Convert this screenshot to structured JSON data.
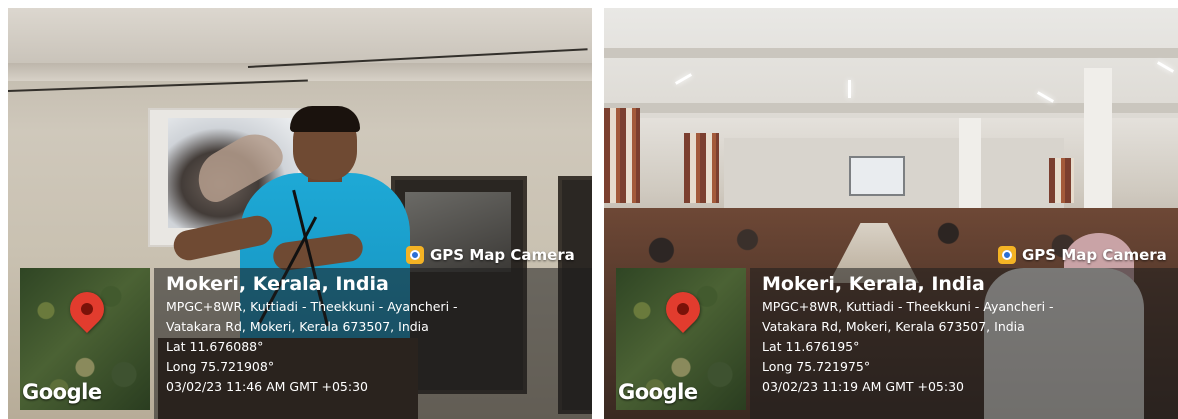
{
  "photos": [
    {
      "badge": "GPS Map Camera",
      "place": "Mokeri, Kerala, India",
      "address_line1": "MPGC+8WR, Kuttiadi - Theekkuni - Ayancheri -",
      "address_line2": "Vatakara Rd, Mokeri, Kerala 673507, India",
      "lat": "Lat 11.676088°",
      "long": "Long 75.721908°",
      "datetime": "03/02/23 11:46 AM GMT +05:30",
      "map_label": "Google",
      "pin_icon": "map-pin-icon",
      "pin_color": "#e23c2e"
    },
    {
      "badge": "GPS Map Camera",
      "place": "Mokeri, Kerala, India",
      "address_line1": "MPGC+8WR, Kuttiadi - Theekkuni - Ayancheri -",
      "address_line2": "Vatakara Rd, Mokeri, Kerala 673507, India",
      "lat": "Lat 11.676195°",
      "long": "Long 75.721975°",
      "datetime": "03/02/23 11:19 AM GMT +05:30",
      "map_label": "Google",
      "pin_icon": "map-pin-icon",
      "pin_color": "#e23c2e"
    }
  ]
}
